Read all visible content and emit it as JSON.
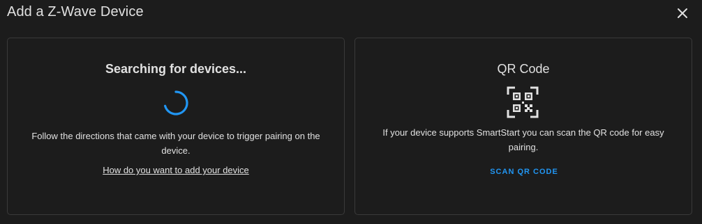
{
  "dialog": {
    "title": "Add a Z-Wave Device",
    "close_icon": "close-icon"
  },
  "search_card": {
    "title": "Searching for devices...",
    "spinner_icon": "loading-spinner-icon",
    "description": "Follow the directions that came with your device to trigger pairing on the device.",
    "link_text": "How do you want to add your device"
  },
  "qr_card": {
    "title": "QR Code",
    "icon": "qr-code-icon",
    "description": "If your device supports SmartStart you can scan the QR code for easy pairing.",
    "button_label": "SCAN QR CODE"
  },
  "colors": {
    "background": "#1c1c1c",
    "border": "#3a3a3a",
    "text": "#e1e1e1",
    "accent": "#2196f3"
  }
}
